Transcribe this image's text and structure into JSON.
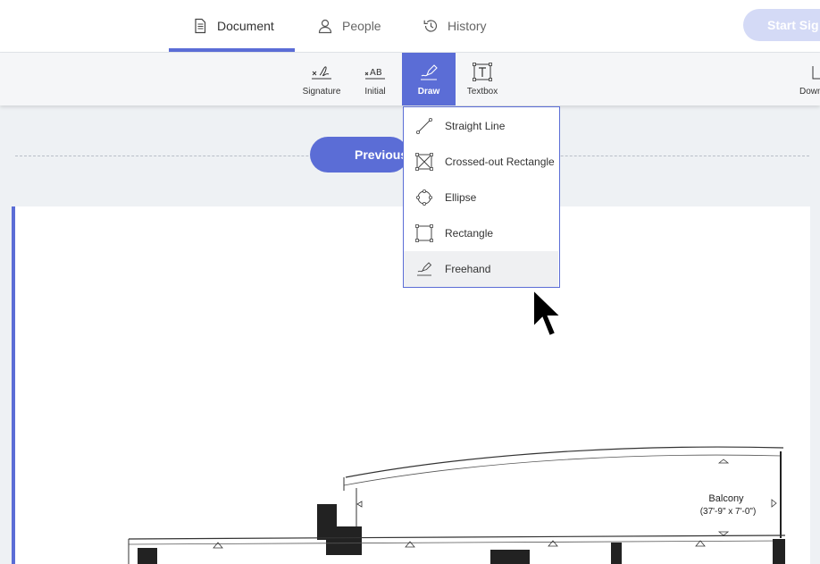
{
  "header": {
    "tabs": [
      {
        "label": "Document",
        "icon": "document-icon",
        "active": true
      },
      {
        "label": "People",
        "icon": "person-icon",
        "active": false
      },
      {
        "label": "History",
        "icon": "history-icon",
        "active": false
      }
    ],
    "start_button": "Start Sig"
  },
  "toolbar": {
    "tools": [
      {
        "label": "Signature",
        "icon": "signature-icon"
      },
      {
        "label": "Initial",
        "icon": "initial-icon"
      },
      {
        "label": "Draw",
        "icon": "draw-pen-icon",
        "active": true
      },
      {
        "label": "Textbox",
        "icon": "textbox-icon"
      },
      {
        "label": "Down",
        "icon": "download-icon"
      }
    ]
  },
  "nav": {
    "previous": "Previous"
  },
  "draw_menu": {
    "items": [
      {
        "label": "Straight Line",
        "icon": "straight-line-icon"
      },
      {
        "label": "Crossed-out Rectangle",
        "icon": "crossed-rectangle-icon"
      },
      {
        "label": "Ellipse",
        "icon": "ellipse-icon"
      },
      {
        "label": "Rectangle",
        "icon": "rectangle-icon"
      },
      {
        "label": "Freehand",
        "icon": "freehand-icon",
        "highlighted": true
      }
    ]
  },
  "document": {
    "balcony_label": "Balcony",
    "balcony_dims": "(37'-9\" x 7'-0\")"
  },
  "colors": {
    "accent": "#5b6dd6",
    "start_disabled": "#d4daf6"
  }
}
